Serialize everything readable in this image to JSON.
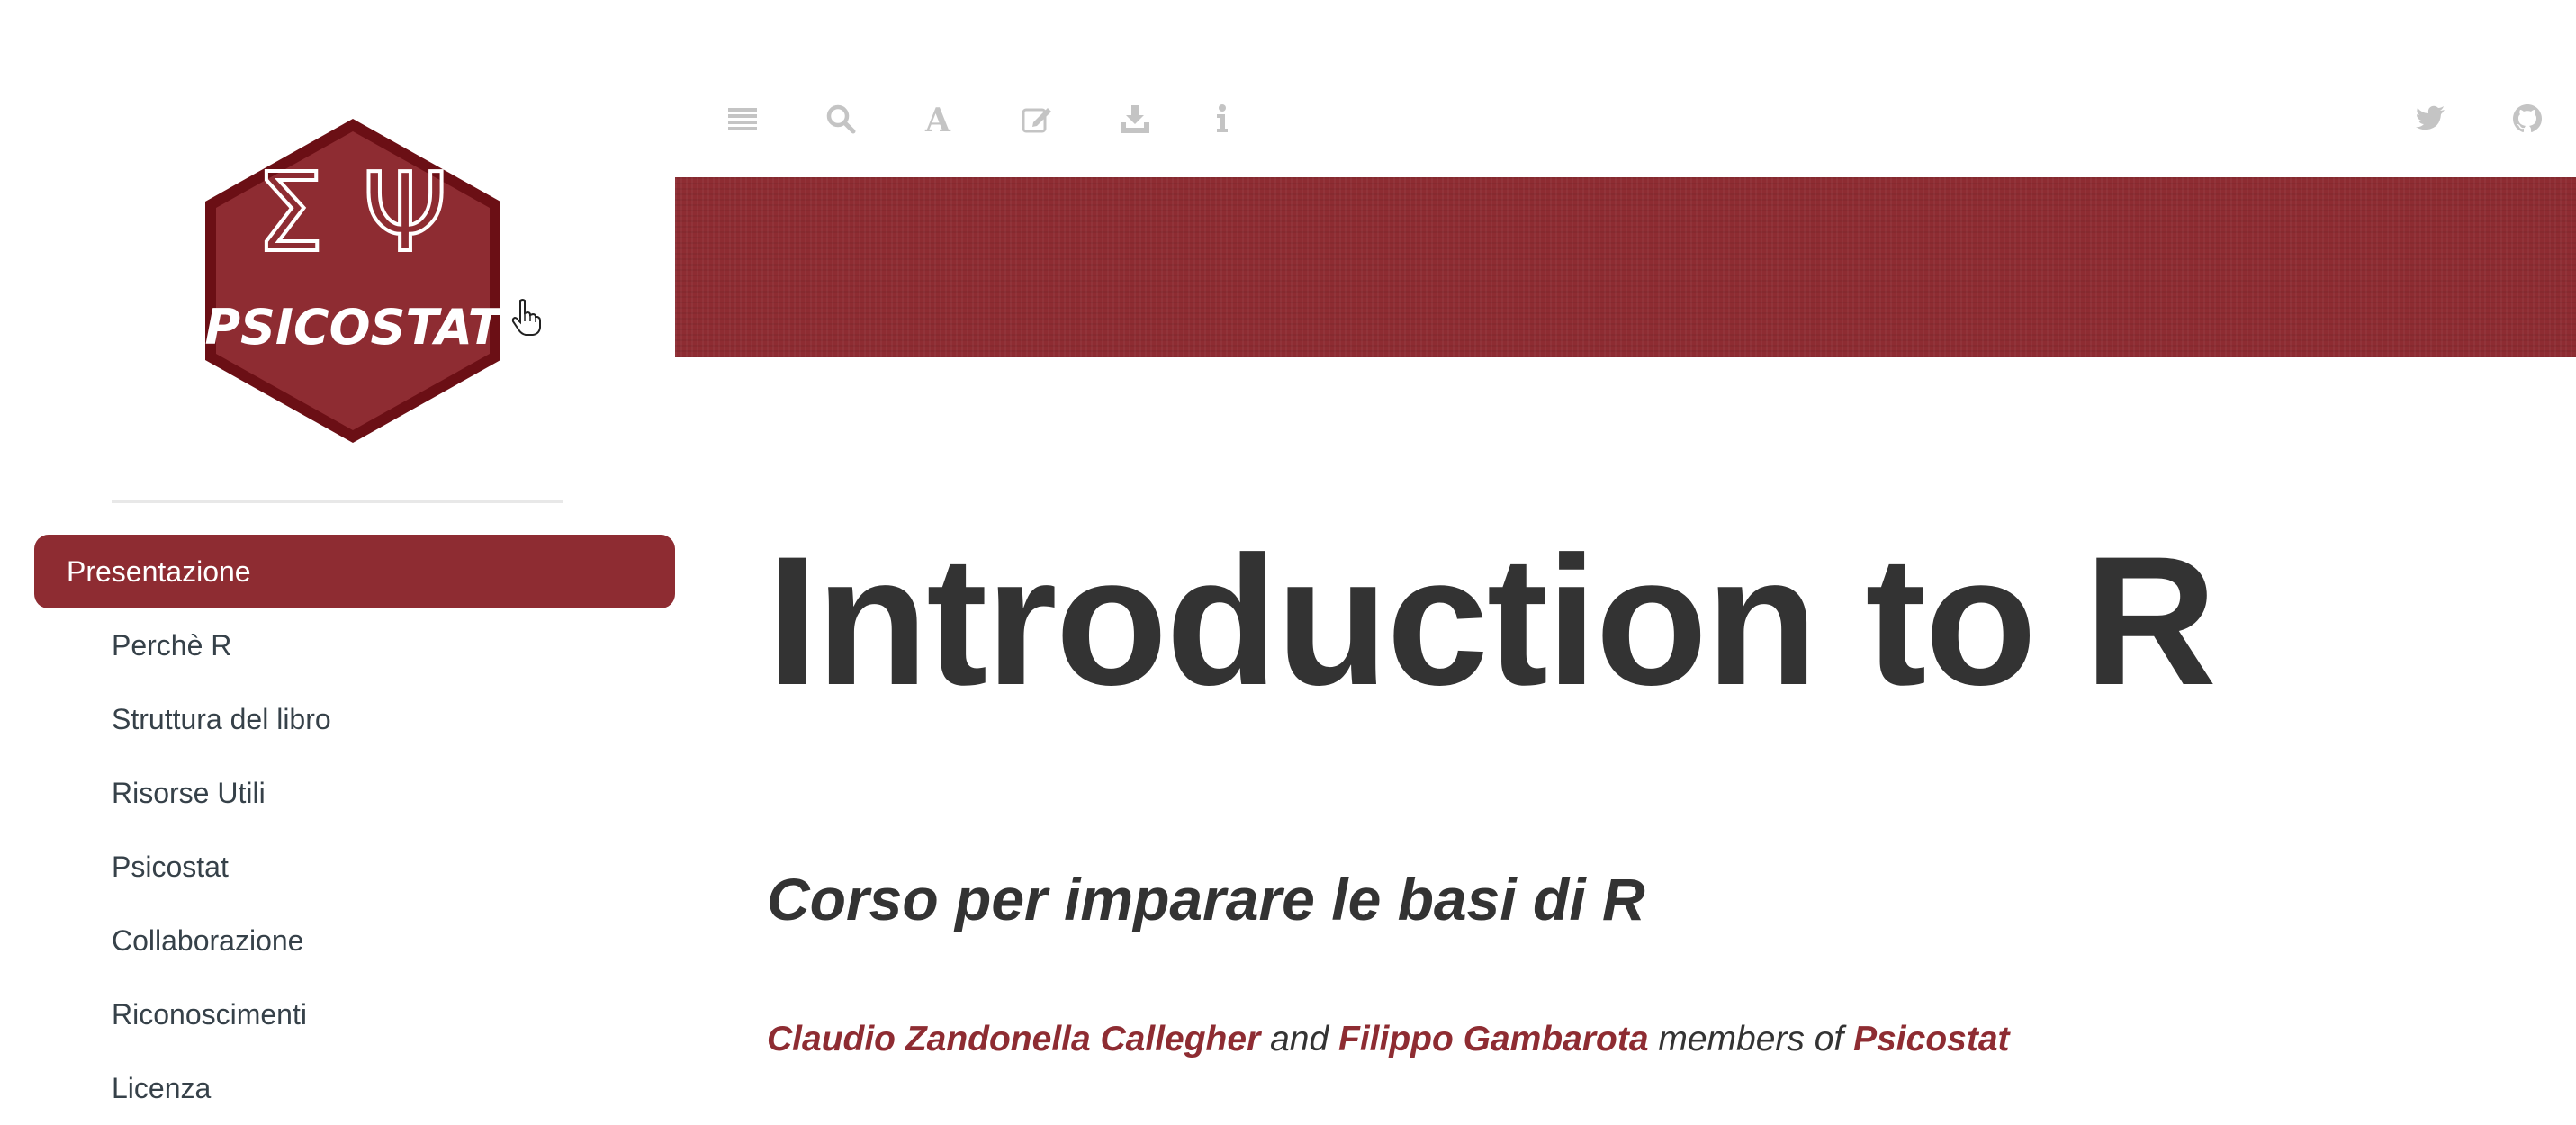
{
  "sidebar": {
    "logo": {
      "symbols": "Σ Ψ",
      "wordmark": "PSICOSTAT",
      "colors": {
        "fill": "#8e2c32",
        "border": "#6b0f15",
        "text": "#ffffff"
      }
    },
    "items": [
      {
        "label": "Presentazione",
        "active": true
      },
      {
        "label": "Perchè R",
        "active": false
      },
      {
        "label": "Struttura del libro",
        "active": false
      },
      {
        "label": "Risorse Utili",
        "active": false
      },
      {
        "label": "Psicostat",
        "active": false
      },
      {
        "label": "Collaborazione",
        "active": false
      },
      {
        "label": "Riconoscimenti",
        "active": false
      },
      {
        "label": "Licenza",
        "active": false
      }
    ]
  },
  "toolbar": {
    "left_icons": [
      "toc-toggle-icon",
      "search-icon",
      "font-settings-icon",
      "edit-icon",
      "download-icon",
      "info-icon"
    ],
    "right_icons": [
      "twitter-icon",
      "github-icon"
    ],
    "icon_color": "#c4c4c4"
  },
  "banner": {
    "color": "#8e2c32"
  },
  "main": {
    "title": "Introduction to R",
    "subtitle": "Corso per imparare le basi di R",
    "authors": {
      "author1": "Claudio Zandonella Callegher",
      "conj": " and ",
      "author2": "Filippo Gambarota",
      "members_of": " members of ",
      "group": "Psicostat"
    }
  },
  "colors": {
    "accent": "#8e2c32",
    "text": "#333333",
    "sidebar_text": "#364149"
  }
}
